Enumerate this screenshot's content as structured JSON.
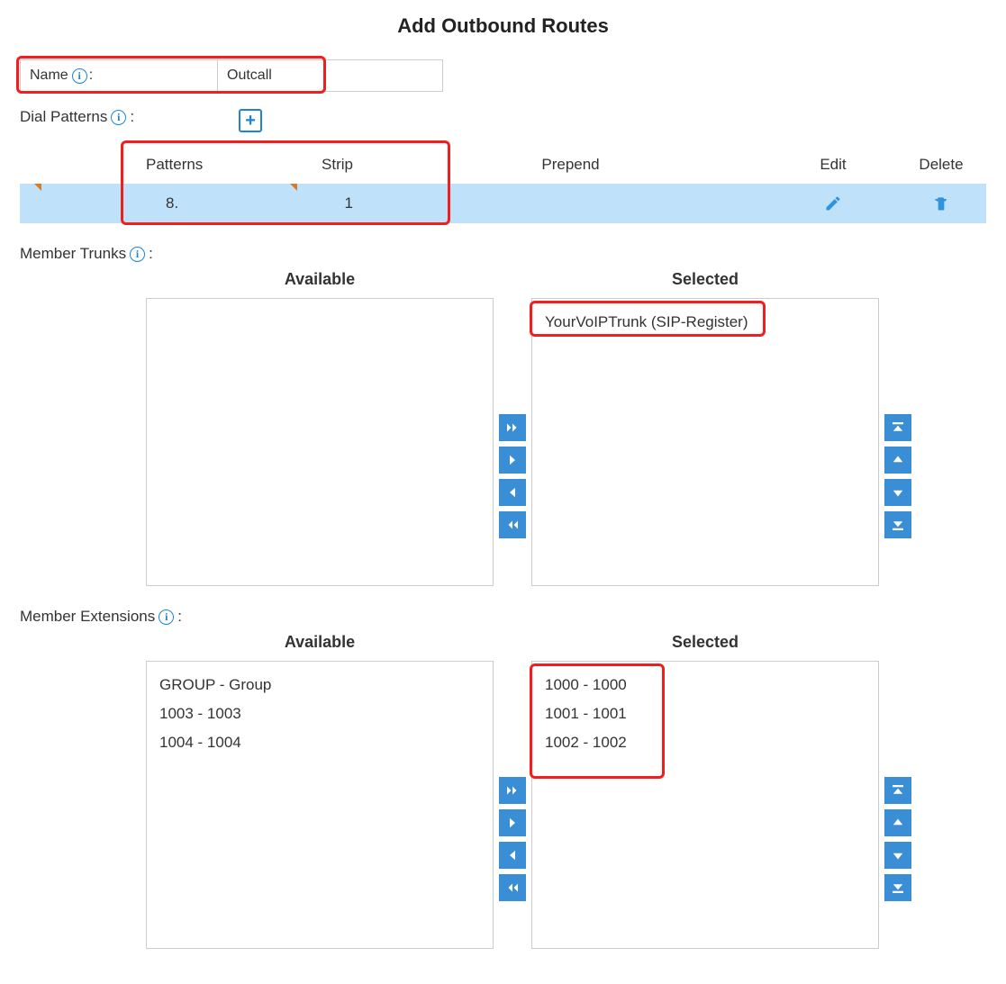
{
  "page": {
    "title": "Add Outbound Routes"
  },
  "name_field": {
    "label": "Name",
    "colon": ":",
    "value": "Outcall"
  },
  "dial_patterns": {
    "label": "Dial Patterns",
    "colon": ":",
    "headers": {
      "patterns": "Patterns",
      "strip": "Strip",
      "prepend": "Prepend",
      "edit": "Edit",
      "delete": "Delete"
    },
    "rows": [
      {
        "pattern": "8.",
        "strip": "1",
        "prepend": ""
      }
    ]
  },
  "member_trunks": {
    "label": "Member Trunks",
    "colon": ":",
    "available_title": "Available",
    "selected_title": "Selected",
    "available": [],
    "selected": [
      "YourVoIPTrunk (SIP-Register)"
    ]
  },
  "member_extensions": {
    "label": "Member Extensions",
    "colon": ":",
    "available_title": "Available",
    "selected_title": "Selected",
    "available": [
      "GROUP - Group",
      "1003 - 1003",
      "1004 - 1004"
    ],
    "selected": [
      "1000 - 1000",
      "1001 - 1001",
      "1002 - 1002"
    ]
  },
  "icons": {
    "info": "i",
    "plus": "+"
  }
}
